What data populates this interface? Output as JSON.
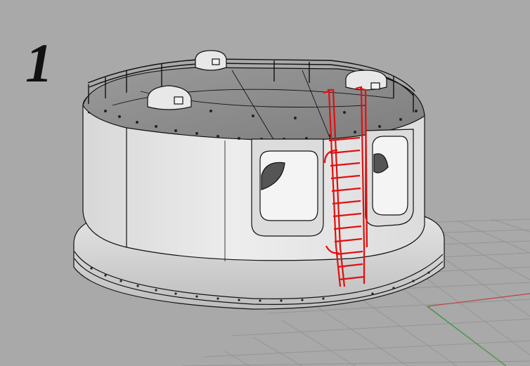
{
  "viewport": {
    "step_label": "1",
    "colors": {
      "background": "#a9a9a9",
      "grid_line": "#8f8f8f",
      "x_axis": "#c43a3a",
      "y_axis": "#3a9a3a",
      "model_fill": "#e3e3e3",
      "model_outline": "#111111",
      "selected_ladder": "#e01010"
    },
    "objects": [
      {
        "name": "turret-body",
        "selected": false
      },
      {
        "name": "ladder",
        "selected": true
      }
    ]
  }
}
